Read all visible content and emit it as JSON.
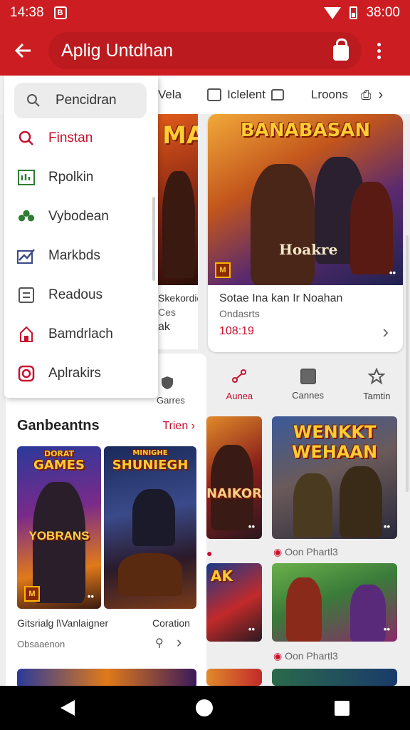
{
  "status": {
    "time": "14:38",
    "notif": "B",
    "clock_right": "38:00"
  },
  "appbar": {
    "title": "Aplig Untdhan"
  },
  "cat_tabs": [
    {
      "label": "Vela"
    },
    {
      "label": "Iclelent"
    },
    {
      "label": "Lroons"
    }
  ],
  "drawer": {
    "search_label": "Pencidran",
    "items": [
      {
        "label": "Finstan",
        "icon": "search-icon"
      },
      {
        "label": "Rpolkin",
        "icon": "chart-icon"
      },
      {
        "label": "Vybodean",
        "icon": "group-icon"
      },
      {
        "label": "Markbds",
        "icon": "trend-icon"
      },
      {
        "label": "Readous",
        "icon": "list-icon"
      },
      {
        "label": "Bamdrlach",
        "icon": "house-icon"
      },
      {
        "label": "Aplrakirs",
        "icon": "camera-icon"
      }
    ]
  },
  "featured_left": {
    "art_title": "MA",
    "line1": "Skekordio",
    "line2": "Ces",
    "line3": "ak"
  },
  "featured": {
    "art_title": "BANABASAN",
    "art_sub": "Hoakre",
    "badge": "M",
    "dots": "••",
    "name": "Sotae Ina kan Ir Noahan",
    "category": "Ondasrts",
    "price": "108:19"
  },
  "quick_tabs": [
    {
      "label": "Garres"
    },
    {
      "label": "Aunea"
    },
    {
      "label": "Cannes"
    },
    {
      "label": "Tamtin"
    }
  ],
  "section": {
    "title": "Ganbeantns",
    "trend_label": "Trien",
    "cards": [
      {
        "art_title": "GAMES",
        "art_top": "DORAT",
        "art_sub": "YOBRANS",
        "name": "Gitsrialg l\\Vanlaigner",
        "sub": "Obsaaenon"
      },
      {
        "art_title": "SHUNIEGH",
        "art_top": "MINIGHE",
        "art_sub": "",
        "name": "Coration",
        "sub": ""
      }
    ]
  },
  "right_grid": [
    {
      "art_title": "NAIKORS",
      "meta": ""
    },
    {
      "art_title": "WENKKT WEHAAN",
      "meta": "Oon Phartl3"
    },
    {
      "art_title": "AK",
      "meta": ""
    },
    {
      "art_title": "",
      "meta": "Oon Phartl3"
    }
  ],
  "colors": {
    "brand": "#cc1e22",
    "accent": "#c8102e"
  }
}
